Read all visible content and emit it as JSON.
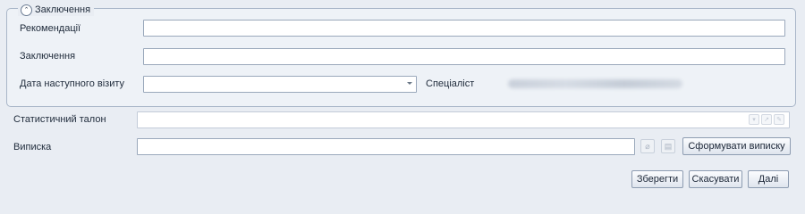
{
  "conclusion_group": {
    "title": "Заключення",
    "collapse_icon": "chevron-up-circle-icon",
    "fields": {
      "recommendations_label": "Рекомендації",
      "recommendations_value": "",
      "conclusion_label": "Заключення",
      "conclusion_value": "",
      "next_visit_label": "Дата наступного візиту",
      "next_visit_value": "",
      "specialist_label": "Спеціаліст"
    }
  },
  "stat_ticket": {
    "label": "Статистичний талон",
    "value": ""
  },
  "discharge": {
    "label": "Виписка",
    "value": "",
    "generate_button": "Сформувати виписку",
    "icons": [
      "attachment-icon",
      "document-icon"
    ]
  },
  "footer": {
    "save_button": "Зберегти",
    "cancel_button": "Скасувати",
    "next_button": "Далі"
  }
}
